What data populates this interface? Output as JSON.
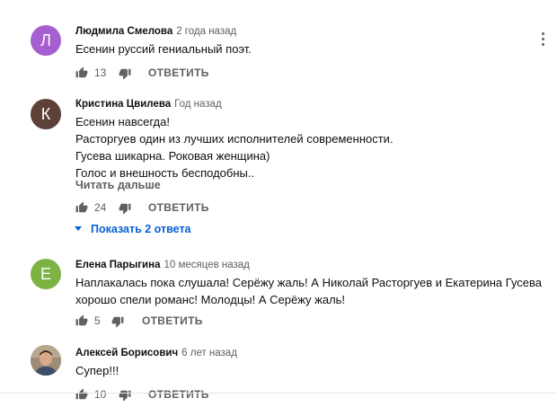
{
  "reply_label": "ОТВЕТИТЬ",
  "comments": [
    {
      "avatar_letter": "Л",
      "avatar_color": "#a65fd0",
      "author": "Людмила Смелова",
      "time": "2 года назад",
      "lines": [
        "Есенин руссий гениальный поэт."
      ],
      "likes": "13"
    },
    {
      "avatar_letter": "К",
      "avatar_color": "#5d4037",
      "author": "Кристина Цвилева",
      "time": "Год назад",
      "lines": [
        "Есенин навсегда!",
        "Расторгуев один из лучших исполнителей современности.",
        "Гусева шикарна. Роковая женщина)",
        "Голос и внешность бесподобны.."
      ],
      "read_more": "Читать дальше",
      "likes": "24",
      "show_replies": "Показать 2 ответа"
    },
    {
      "avatar_letter": "Е",
      "avatar_color": "#7cb342",
      "author": "Елена Парыгина",
      "time": "10 месяцев назад",
      "lines": [
        "Наплакалась пока слушала! Серёжу жаль! А Николай Расторгуев и Екатерина Гусева",
        "хорошо спели романс! Молодцы! А Серёжу жаль!"
      ],
      "likes": "5"
    },
    {
      "avatar_letter": "",
      "avatar_color": "#8a7a66",
      "author": "Алексей Борисович",
      "time": "6 лет назад",
      "lines": [
        "Супер!!!"
      ],
      "likes": "10"
    }
  ]
}
